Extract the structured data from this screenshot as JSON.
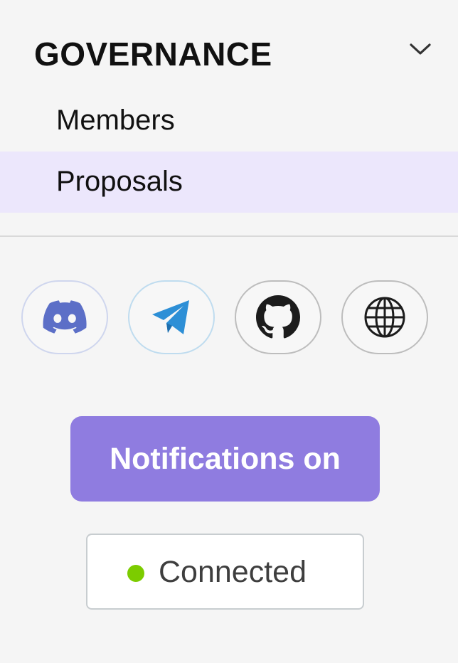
{
  "section": {
    "title": "GOVERNANCE",
    "expanded": true,
    "items": [
      {
        "label": "Members",
        "active": false
      },
      {
        "label": "Proposals",
        "active": true
      }
    ]
  },
  "socials": [
    {
      "name": "Discord",
      "icon": "discord-icon",
      "color": "#5c6fc7"
    },
    {
      "name": "Telegram",
      "icon": "telegram-icon",
      "color": "#2d8fd6"
    },
    {
      "name": "GitHub",
      "icon": "github-icon",
      "color": "#1c1c1c"
    },
    {
      "name": "Website",
      "icon": "globe-icon",
      "color": "#1c1c1c"
    }
  ],
  "notifications": {
    "label": "Notifications on",
    "color": "#8f7ce0"
  },
  "connection": {
    "label": "Connected",
    "dot_color": "#7ccc00"
  }
}
